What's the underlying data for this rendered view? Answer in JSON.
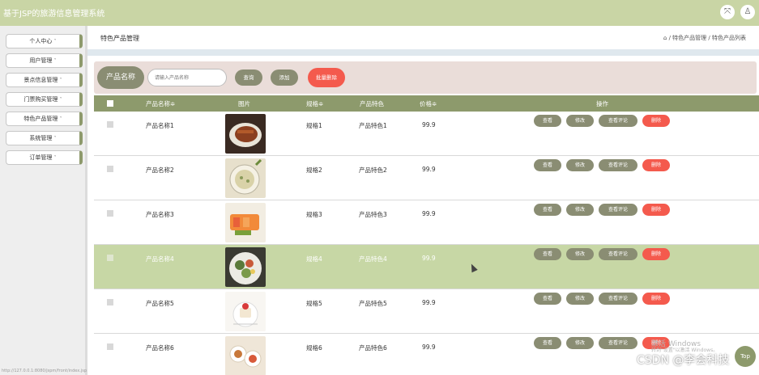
{
  "app": {
    "title": "基于JSP的旅游信息管理系统",
    "fullscreen_icon": "⤧",
    "user_icon": "♙"
  },
  "sidebar": {
    "items": [
      {
        "label": "个人中心"
      },
      {
        "label": "用户管理"
      },
      {
        "label": "景点信息管理"
      },
      {
        "label": "门票购买管理"
      },
      {
        "label": "特色产品管理"
      },
      {
        "label": "系统管理"
      },
      {
        "label": "订单管理"
      }
    ],
    "caret": "˅"
  },
  "header": {
    "page_title": "特色产品管理",
    "breadcrumb": {
      "home_icon": "⌂",
      "sep": "/",
      "crumb1": "特色产品管理",
      "crumb2": "特色产品列表"
    }
  },
  "search": {
    "label": "产品名称",
    "placeholder": "请输入产品名称",
    "query_label": "查询",
    "add_label": "添加",
    "batch_delete_label": "批量删除"
  },
  "table": {
    "columns": {
      "name": "产品名称≑",
      "image": "图片",
      "spec": "规格≑",
      "feature": "产品特色",
      "price": "价格≑",
      "actions": "操作"
    },
    "action_labels": {
      "view": "查看",
      "edit": "修改",
      "review": "查看评论",
      "delete": "删除"
    },
    "rows": [
      {
        "name": "产品名称1",
        "spec": "规格1",
        "feature": "产品特色1",
        "price": "99.9"
      },
      {
        "name": "产品名称2",
        "spec": "规格2",
        "feature": "产品特色2",
        "price": "99.9"
      },
      {
        "name": "产品名称3",
        "spec": "规格3",
        "feature": "产品特色3",
        "price": "99.9"
      },
      {
        "name": "产品名称4",
        "spec": "规格4",
        "feature": "产品特色4",
        "price": "99.9"
      },
      {
        "name": "产品名称5",
        "spec": "规格5",
        "feature": "产品特色5",
        "price": "99.9"
      },
      {
        "name": "产品名称6",
        "spec": "规格6",
        "feature": "产品特色6",
        "price": "99.9"
      }
    ]
  },
  "overlay": {
    "status_url": "http://127.0.0.1:8080/jspm/front/index.jsp",
    "windows_watermark": "激活 Windows",
    "windows_watermark_sub": "转到\"设置\"以激活 Windows。",
    "csdn": "CSDN @李会科技",
    "fab": "Top"
  },
  "colors": {
    "topbar": "#c9d5a5",
    "table_header": "#8d9a6c",
    "button_olive": "#8a8d73",
    "button_red": "#f45a4d",
    "highlight_row": "#c7d7a5",
    "search_panel": "#eaddd9"
  }
}
